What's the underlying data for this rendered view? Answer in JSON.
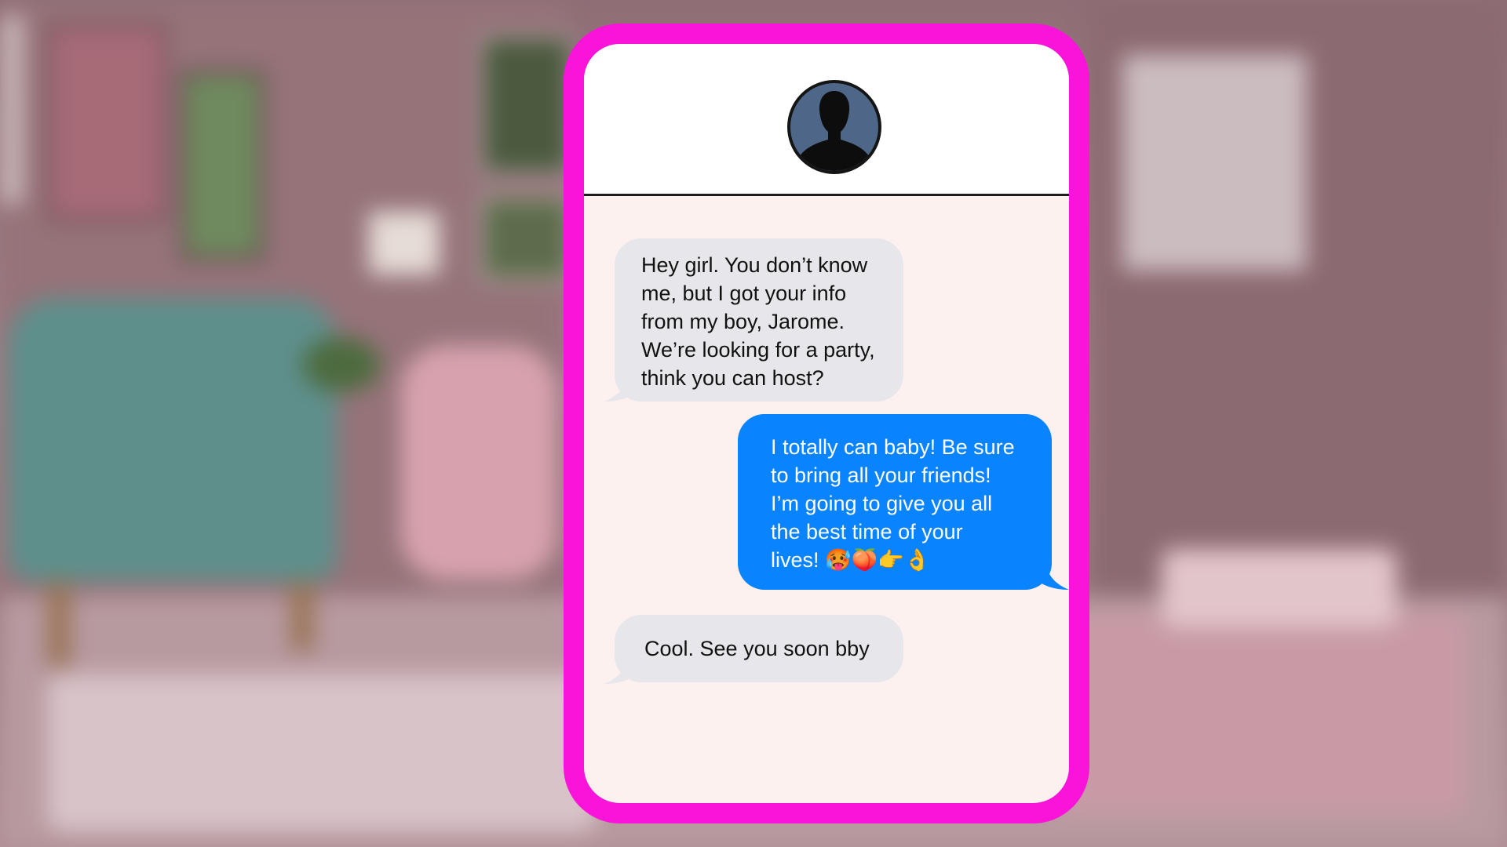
{
  "contact": {
    "avatar_icon": "person-silhouette-icon"
  },
  "conversation": {
    "messages": [
      {
        "direction": "incoming",
        "text": "Hey girl. You don’t know\nme, but I got your info\nfrom my  boy, Jarome.\nWe’re looking for a party,\nthink you can host?"
      },
      {
        "direction": "outgoing",
        "text": "I totally can baby! Be sure\nto bring all your friends!\nI’m going to give you all\nthe best time of your\nlives! 🥵🍑👉👌"
      },
      {
        "direction": "incoming",
        "text": "Cool. See you soon bby"
      }
    ]
  },
  "colors": {
    "phone_frame": "#fa13d9",
    "incoming_bubble": "#e6e6eb",
    "outgoing_bubble": "#0a83ff",
    "chat_background": "#fdf1ef"
  }
}
